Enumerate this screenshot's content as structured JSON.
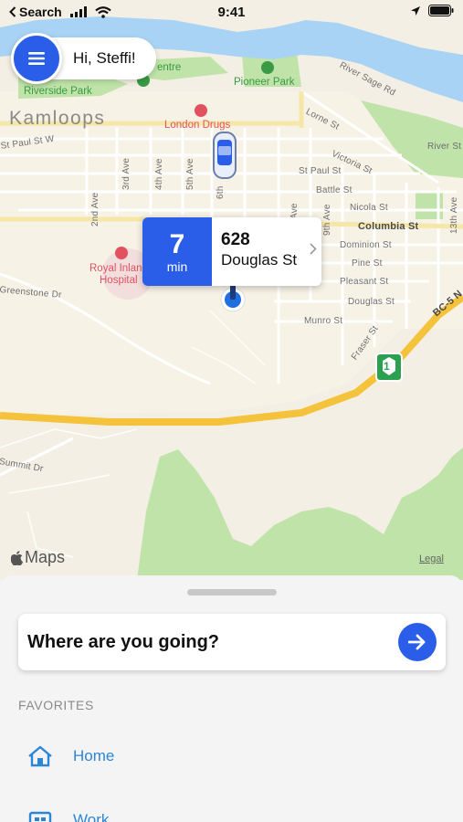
{
  "status_bar": {
    "back_label": "Search",
    "time": "9:41"
  },
  "greeting": {
    "text": "Hi, Steffi!"
  },
  "map": {
    "city": "Kamloops",
    "parks": [
      "Riverside Park",
      "Pioneer Park"
    ],
    "centre_fragment": "entre",
    "pois": [
      "London Drugs",
      "Royal Inland",
      "Hospital"
    ],
    "streets": [
      "River Sage Rd",
      "Lorne St",
      "River St",
      "Victoria St",
      "St Paul St W",
      "St Paul St",
      "Battle St",
      "Nicola St",
      "Columbia St",
      "Dominion St",
      "Pine St",
      "Pleasant St",
      "Douglas St",
      "Munro St",
      "Fraser St",
      "BC-5 N",
      "Greenstone Dr",
      "Summit Dr",
      "2nd Ave",
      "3rd Ave",
      "4th Ave",
      "5th Ave",
      "6th",
      "Ave",
      "9th Ave",
      "13th Ave"
    ],
    "highway_shield": "1",
    "attribution": "Maps",
    "legal": "Legal"
  },
  "eta": {
    "minutes": "7",
    "unit": "min",
    "address_line1": "628",
    "address_line2": "Douglas St"
  },
  "sheet": {
    "search_placeholder": "Where are you going?",
    "favorites_title": "FAVORITES",
    "favorites": [
      {
        "label": "Home",
        "icon": "home-icon"
      },
      {
        "label": "Work",
        "icon": "briefcase-icon"
      }
    ]
  },
  "colors": {
    "accent": "#2b5ee8",
    "link": "#2b86d6",
    "water": "#a9d3f5",
    "park": "#bfe3a8",
    "highway": "#f5c33b"
  }
}
